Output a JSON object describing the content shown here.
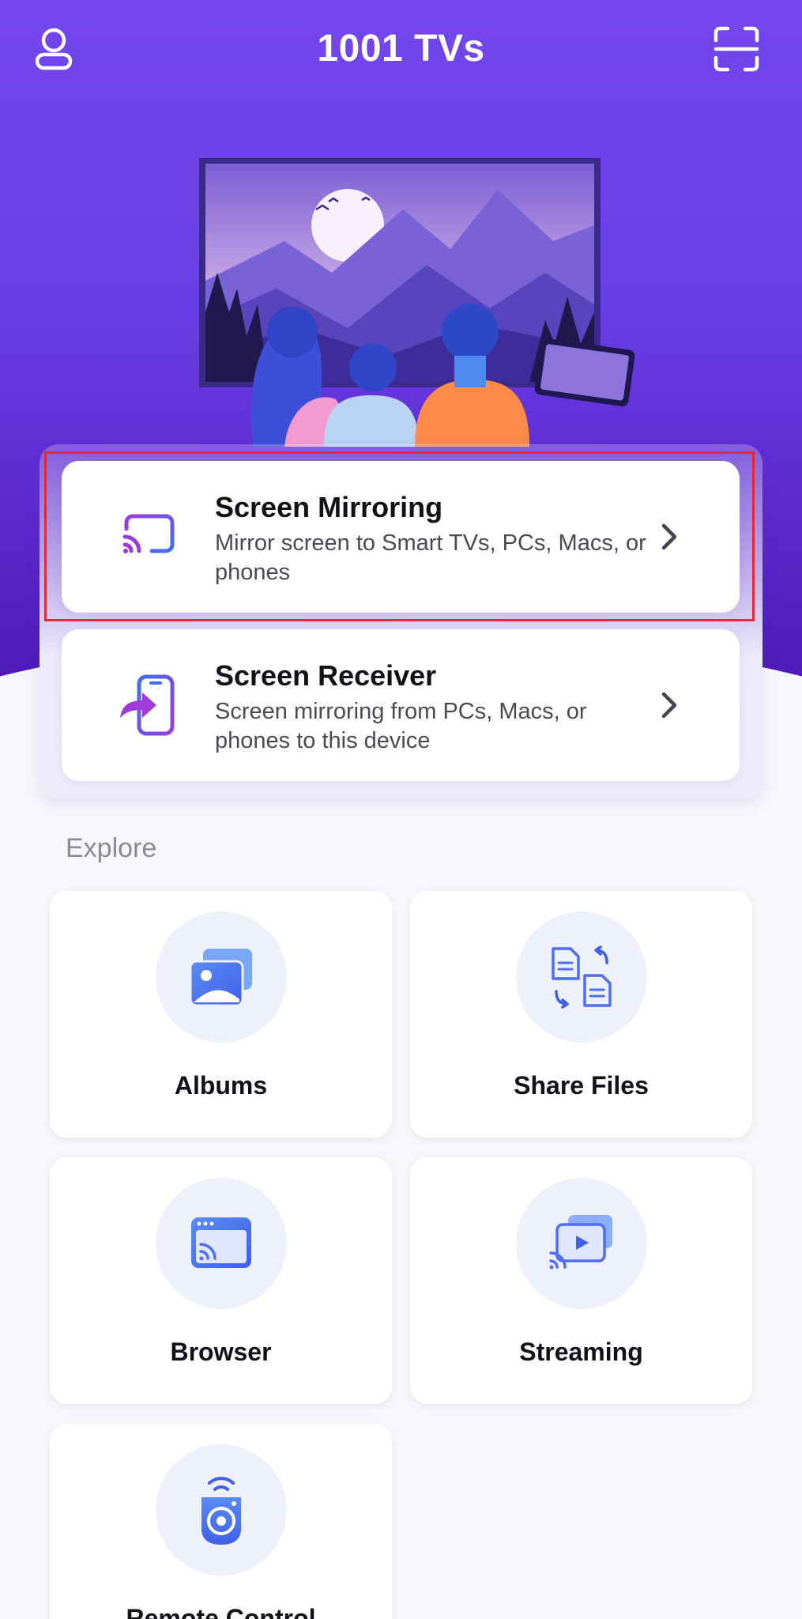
{
  "app": {
    "title": "1001 TVs"
  },
  "icons": {
    "profile": "user-icon",
    "scan": "scan-icon",
    "mirroring": "cast-icon",
    "receiver": "phone-receive-icon",
    "chevron": "chevron-right-icon",
    "albums": "photos-icon",
    "share_files": "file-transfer-icon",
    "browser": "browser-cast-icon",
    "streaming": "video-stream-icon",
    "remote": "remote-icon"
  },
  "features": {
    "mirroring": {
      "title": "Screen Mirroring",
      "description": "Mirror screen to Smart TVs, PCs, Macs, or phones"
    },
    "receiver": {
      "title": "Screen Receiver",
      "description": "Screen mirroring from PCs, Macs, or phones to this device"
    }
  },
  "explore": {
    "heading": "Explore",
    "tiles": [
      {
        "label": "Albums"
      },
      {
        "label": "Share Files"
      },
      {
        "label": "Browser"
      },
      {
        "label": "Streaming"
      },
      {
        "label": "Remote Control"
      }
    ]
  },
  "colors": {
    "brand_purple": "#7446ec",
    "icon_gradient_start": "#9a3bdc",
    "icon_gradient_end": "#3f6ff0",
    "highlight": "#e02a3a"
  }
}
